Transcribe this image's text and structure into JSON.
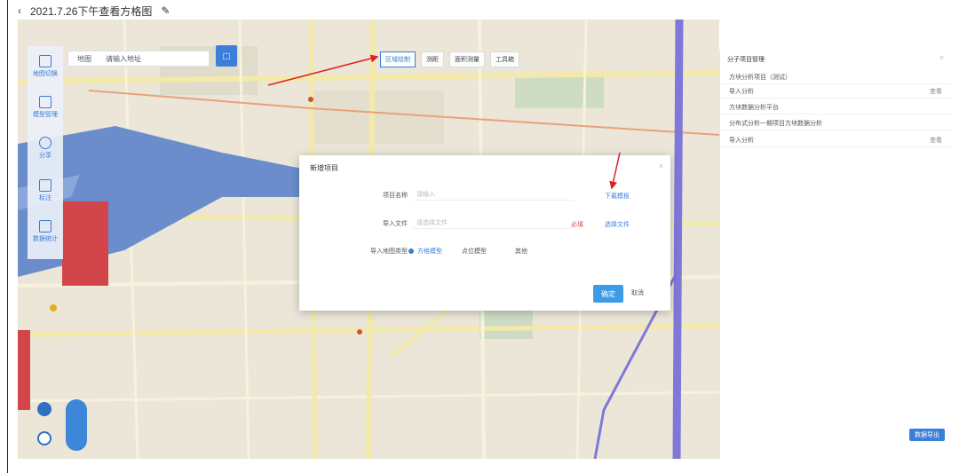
{
  "window": {
    "back_icon": "chevron-left-icon",
    "title": "2021.7.26下午查看方格图",
    "edit_icon": "pencil-icon"
  },
  "toolbar": {
    "items": [
      {
        "label": "地图切换",
        "icon": "map-icon"
      },
      {
        "label": "模型管理",
        "icon": "layers-icon"
      },
      {
        "label": "分享",
        "icon": "share-icon"
      },
      {
        "label": "标注",
        "icon": "marker-icon"
      },
      {
        "label": "数据统计",
        "icon": "chart-icon"
      }
    ]
  },
  "search": {
    "city": "地图",
    "placeholder": "请输入地址",
    "button_icon": "search-icon"
  },
  "map_tools": [
    "区域绘制",
    "测距",
    "面积测量",
    "工具箱"
  ],
  "panel": {
    "title": "分子项目管理",
    "rows": [
      {
        "label": "方块分析项目（测试）",
        "value": ""
      },
      {
        "label": "导入分析",
        "value": "查看"
      },
      {
        "label": "方块数据分析平台",
        "value": ""
      },
      {
        "label": "分布式分析一期项目方块数据分析",
        "value": ""
      },
      {
        "label": "导入分析",
        "value": "查看"
      }
    ],
    "button": "数据导出"
  },
  "modal": {
    "title": "新增项目",
    "fields": [
      {
        "label": "项目名称",
        "placeholder": "请输入",
        "link": "下载模板"
      },
      {
        "label": "导入文件",
        "placeholder": "请选择文件",
        "error": "必填",
        "link": "选择文件"
      }
    ],
    "radio_label": "导入地图类型",
    "radio_options": [
      {
        "label": "方格模型",
        "checked": true
      },
      {
        "label": "点位模型",
        "checked": false
      },
      {
        "label": "其他",
        "checked": false
      }
    ],
    "ok": "确定",
    "cancel": "取消"
  },
  "colors": {
    "accent": "#3b7fd9",
    "error": "#e24b4b",
    "river": "#5b7fbf",
    "highlight": "#d2454a"
  }
}
